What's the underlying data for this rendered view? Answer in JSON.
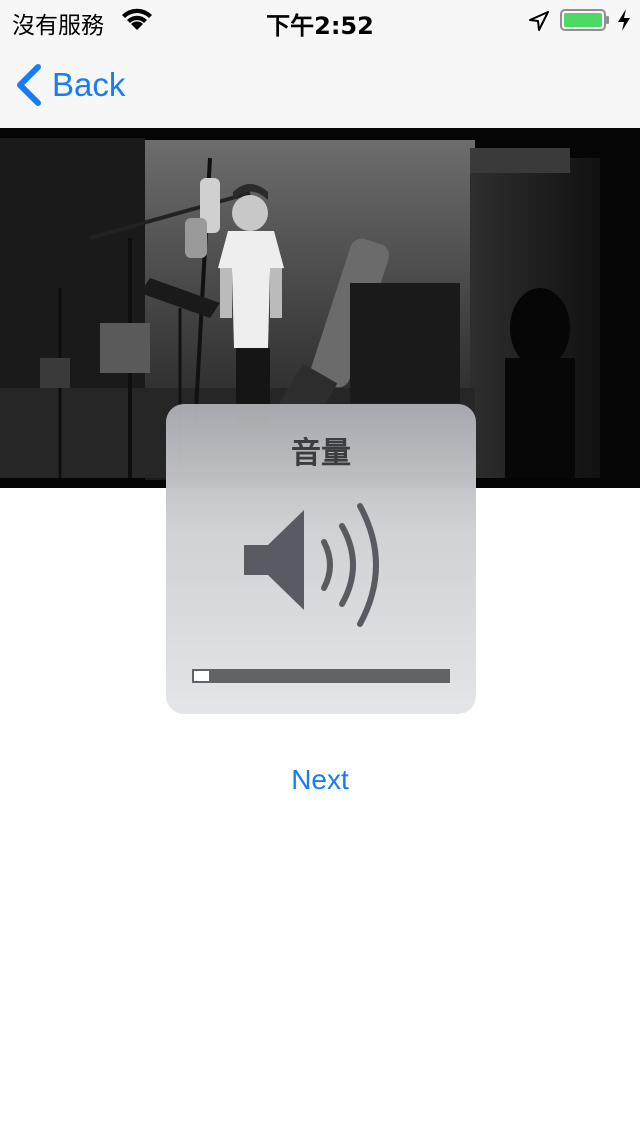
{
  "status_bar": {
    "carrier": "沒有服務",
    "time": "下午2:52",
    "icons": [
      "wifi-icon",
      "location-arrow-icon",
      "battery-icon",
      "charging-bolt-icon"
    ],
    "battery_color": "#4cd964"
  },
  "nav": {
    "back_label": "Back",
    "accent_color": "#1a7cf4"
  },
  "video": {
    "description_icon": "video-frame"
  },
  "volume_hud": {
    "title": "音量",
    "icon": "speaker-icon",
    "level": 0.06
  },
  "next_label": "Next"
}
